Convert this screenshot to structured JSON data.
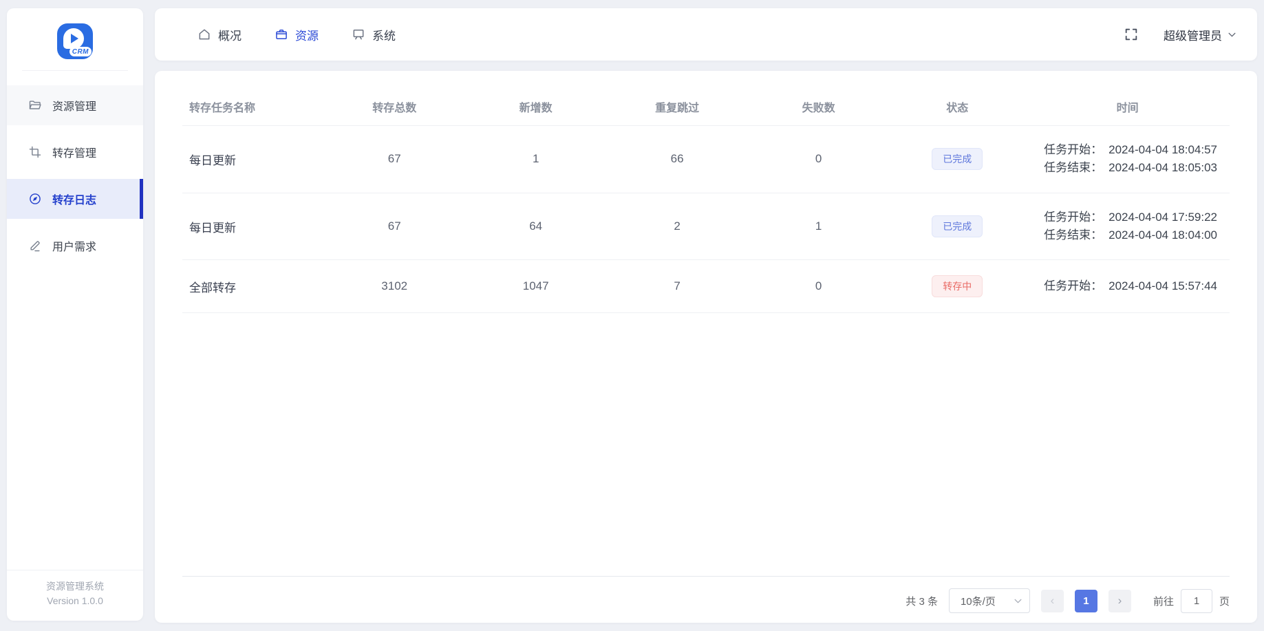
{
  "colors": {
    "accent": "#2b4ad6",
    "accent_bar": "#2132c0",
    "menu_active_bg": "#e8ecfa",
    "badge_done_text": "#5e77dc",
    "badge_running_text": "#e96b66",
    "pagination_active_bg": "#5677e3",
    "logo_blue": "#2a6ce2"
  },
  "logo": {
    "text": "CRM"
  },
  "sidebar": {
    "items": [
      {
        "label": "资源管理",
        "icon": "folder",
        "active": false,
        "hovered": true
      },
      {
        "label": "转存管理",
        "icon": "crop",
        "active": false,
        "hovered": false
      },
      {
        "label": "转存日志",
        "icon": "compass",
        "active": true,
        "hovered": false
      },
      {
        "label": "用户需求",
        "icon": "edit",
        "active": false,
        "hovered": false
      }
    ],
    "footer_title": "资源管理系统",
    "footer_version": "Version 1.0.0"
  },
  "header": {
    "nav": [
      {
        "label": "概况",
        "icon": "home",
        "active": false
      },
      {
        "label": "资源",
        "icon": "briefcase",
        "active": true
      },
      {
        "label": "系统",
        "icon": "screen",
        "active": false
      }
    ],
    "user_name": "超级管理员"
  },
  "table": {
    "columns": [
      "转存任务名称",
      "转存总数",
      "新增数",
      "重复跳过",
      "失败数",
      "状态",
      "时间"
    ],
    "rows": [
      {
        "name": "每日更新",
        "total": "67",
        "added": "1",
        "skipped": "66",
        "failed": "0",
        "status": {
          "label": "已完成",
          "type": "done"
        },
        "times": [
          {
            "label": "任务开始：",
            "value": "2024-04-04 18:04:57"
          },
          {
            "label": "任务结束：",
            "value": "2024-04-04 18:05:03"
          }
        ]
      },
      {
        "name": "每日更新",
        "total": "67",
        "added": "64",
        "skipped": "2",
        "failed": "1",
        "status": {
          "label": "已完成",
          "type": "done"
        },
        "times": [
          {
            "label": "任务开始：",
            "value": "2024-04-04 17:59:22"
          },
          {
            "label": "任务结束：",
            "value": "2024-04-04 18:04:00"
          }
        ]
      },
      {
        "name": "全部转存",
        "total": "3102",
        "added": "1047",
        "skipped": "7",
        "failed": "0",
        "status": {
          "label": "转存中",
          "type": "running"
        },
        "times": [
          {
            "label": "任务开始：",
            "value": "2024-04-04 15:57:44"
          }
        ]
      }
    ]
  },
  "pagination": {
    "total_text": "共 3 条",
    "page_size": "10条/页",
    "prev": "‹",
    "next": "›",
    "pages": [
      "1"
    ],
    "current_page": "1",
    "goto_label": "前往",
    "goto_value": "1",
    "goto_suffix": "页"
  }
}
